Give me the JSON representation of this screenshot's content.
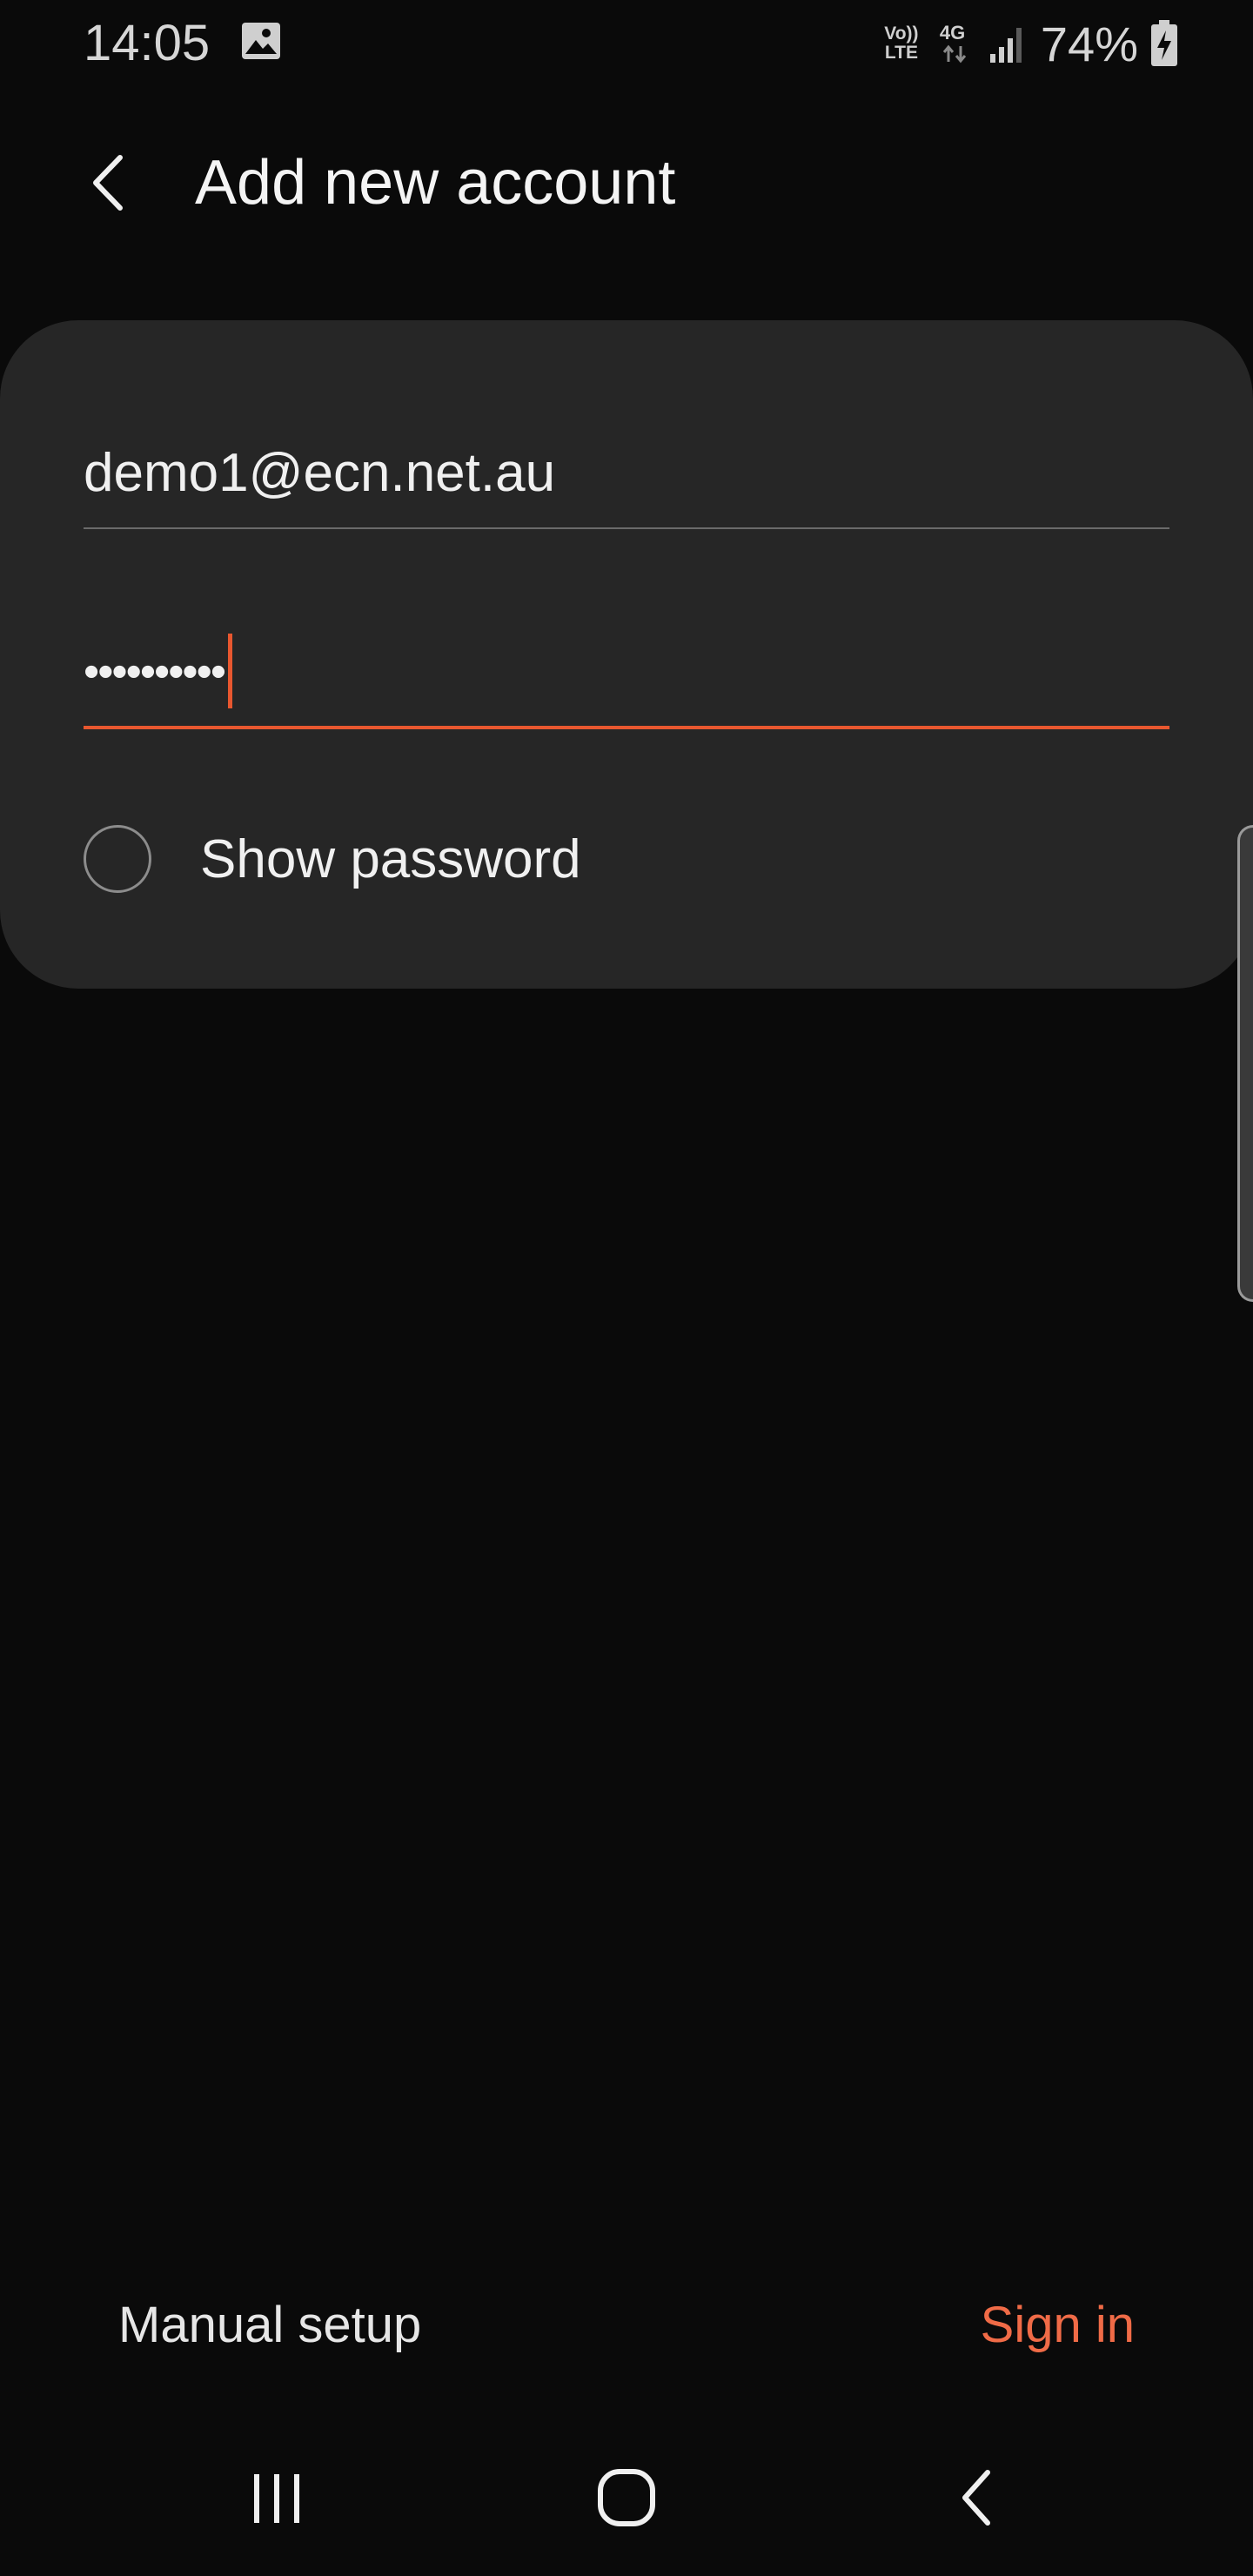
{
  "status_bar": {
    "time": "14:05",
    "volte_top": "Vo))",
    "volte_bottom": "LTE",
    "network": "4G",
    "battery": "74%",
    "icons": [
      "gallery-icon",
      "volte-icon",
      "4g-icon",
      "signal-icon",
      "battery-charging-icon"
    ]
  },
  "app_bar": {
    "title": "Add new account"
  },
  "form": {
    "email_value": "demo1@ecn.net.au",
    "password_value": "••••••••••",
    "show_password_label": "Show password",
    "show_password_checked": false
  },
  "actions": {
    "manual_setup": "Manual setup",
    "sign_in": "Sign in"
  },
  "colors": {
    "accent": "#e8572f",
    "sign_in": "#f06b47",
    "background": "#0a0a0a",
    "card": "#262626"
  },
  "nav": {
    "icons": [
      "recents-icon",
      "home-icon",
      "back-icon"
    ]
  }
}
